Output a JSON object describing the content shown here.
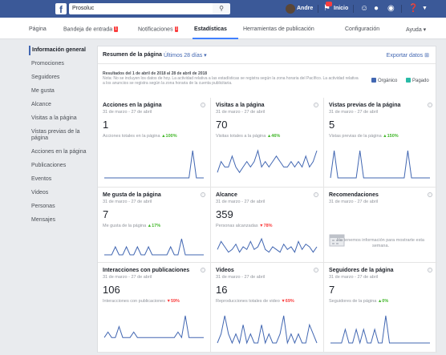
{
  "topbar": {
    "logo": "f",
    "search_value": "Prosoluc",
    "user_name": "Andre",
    "home_label": "Inicio"
  },
  "subnav": {
    "items": [
      {
        "label": "Página"
      },
      {
        "label": "Bandeja de entrada",
        "badge": "1"
      },
      {
        "label": "Notificaciones",
        "badge": "1"
      },
      {
        "label": "Estadísticas"
      },
      {
        "label": "Herramientas de publicación"
      },
      {
        "label": "Configuración"
      },
      {
        "label": "Ayuda ▾"
      }
    ]
  },
  "sidebar": {
    "items": [
      {
        "label": "Información general"
      },
      {
        "label": "Promociones"
      },
      {
        "label": "Seguidores"
      },
      {
        "label": "Me gusta"
      },
      {
        "label": "Alcance"
      },
      {
        "label": "Visitas a la página"
      },
      {
        "label": "Vistas previas de la página"
      },
      {
        "label": "Acciones en la página"
      },
      {
        "label": "Publicaciones"
      },
      {
        "label": "Eventos"
      },
      {
        "label": "Videos"
      },
      {
        "label": "Personas"
      },
      {
        "label": "Mensajes"
      }
    ]
  },
  "main": {
    "title": "Resumen de la página",
    "range": "Últimos 28 días ▾",
    "export": "Exportar datos ⊞",
    "note_results": "Resultados del 1 de abril de 2018 al 28 de abril de 2018",
    "note_text": "Nota: No se incluyen los datos de hoy. La actividad relativa a las estadísticas se registra según la zona horaria del Pacífico. La actividad relativa a los anuncios se registra según la zona horaria de la cuenta publicitaria.",
    "legend_organic": "Orgánico",
    "legend_paid": "Pagado",
    "colors": {
      "organic": "#4267b2",
      "paid": "#2abba7",
      "line": "#4267b2"
    }
  },
  "cards": [
    {
      "title": "Acciones en la página",
      "dates": "31 de marzo - 27 de abril",
      "value": "1",
      "sub": "Acciones totales en la página",
      "change": "▲100%",
      "trend": "up",
      "spark": [
        0,
        0,
        0,
        0,
        0,
        0,
        0,
        0,
        0,
        0,
        0,
        0,
        0,
        0,
        0,
        0,
        0,
        0,
        0,
        0,
        0,
        0,
        0,
        0,
        1,
        0,
        0,
        0
      ]
    },
    {
      "title": "Visitas a la página",
      "dates": "31 de marzo - 27 de abril",
      "value": "70",
      "sub": "Visitas totales a la página",
      "change": "▲46%",
      "trend": "up",
      "spark": [
        1,
        3,
        2,
        2,
        4,
        2,
        1,
        2,
        3,
        2,
        3,
        5,
        2,
        3,
        2,
        3,
        4,
        3,
        2,
        2,
        3,
        2,
        3,
        2,
        4,
        2,
        3,
        5
      ]
    },
    {
      "title": "Vistas previas de la página",
      "dates": "31 de marzo - 27 de abril",
      "value": "5",
      "sub": "Vistas previas de la página",
      "change": "▲150%",
      "trend": "up",
      "spark": [
        0,
        1,
        0,
        0,
        0,
        0,
        0,
        0,
        1,
        0,
        0,
        0,
        0,
        0,
        0,
        0,
        0,
        0,
        0,
        0,
        0,
        1,
        0,
        0,
        0,
        0,
        0,
        0
      ]
    },
    {
      "title": "Me gusta de la página",
      "dates": "31 de marzo - 27 de abril",
      "value": "7",
      "sub": "Me gusta de la página",
      "change": "▲17%",
      "trend": "up",
      "spark": [
        0,
        0,
        0,
        1,
        0,
        0,
        1,
        0,
        0,
        1,
        0,
        0,
        1,
        0,
        0,
        0,
        0,
        0,
        1,
        0,
        0,
        2,
        0,
        0,
        0,
        0,
        0,
        0
      ]
    },
    {
      "title": "Alcance",
      "dates": "31 de marzo - 27 de abril",
      "value": "359",
      "sub": "Personas alcanzadas",
      "change": "▼78%",
      "trend": "down",
      "spark": [
        2,
        5,
        3,
        1,
        2,
        4,
        1,
        3,
        2,
        5,
        2,
        3,
        6,
        2,
        1,
        3,
        2,
        1,
        4,
        2,
        3,
        1,
        5,
        2,
        4,
        3,
        1,
        3
      ]
    },
    {
      "title": "Recomendaciones",
      "dates": "31 de marzo - 27 de abril",
      "value": "",
      "sub": "",
      "change": "",
      "trend": "none",
      "empty": "No tenemos información para mostrarte esta semana.",
      "spark": []
    },
    {
      "title": "Interacciones con publicaciones",
      "dates": "31 de marzo - 27 de abril",
      "value": "106",
      "sub": "Interacciones con publicaciones",
      "change": "▼59%",
      "trend": "down",
      "spark": [
        1,
        2,
        1,
        1,
        3,
        1,
        1,
        1,
        2,
        1,
        1,
        1,
        1,
        1,
        1,
        1,
        1,
        1,
        1,
        1,
        2,
        1,
        5,
        1,
        1,
        1,
        1,
        1
      ]
    },
    {
      "title": "Videos",
      "dates": "31 de marzo - 27 de abril",
      "value": "16",
      "sub": "Reproducciones totales de video",
      "change": "▼69%",
      "trend": "down",
      "spark": [
        0,
        1,
        3,
        1,
        0,
        1,
        0,
        2,
        0,
        1,
        0,
        0,
        2,
        0,
        1,
        0,
        0,
        1,
        3,
        0,
        1,
        0,
        1,
        0,
        0,
        2,
        1,
        0
      ]
    },
    {
      "title": "Seguidores de la página",
      "dates": "31 de marzo - 27 de abril",
      "value": "7",
      "sub": "Seguidores de la página",
      "change": "▲0%",
      "trend": "up",
      "spark": [
        0,
        0,
        0,
        0,
        1,
        0,
        0,
        1,
        0,
        1,
        0,
        0,
        1,
        0,
        0,
        2,
        0,
        0,
        0,
        0,
        0,
        0,
        0,
        0,
        0,
        0,
        0,
        0
      ]
    }
  ]
}
